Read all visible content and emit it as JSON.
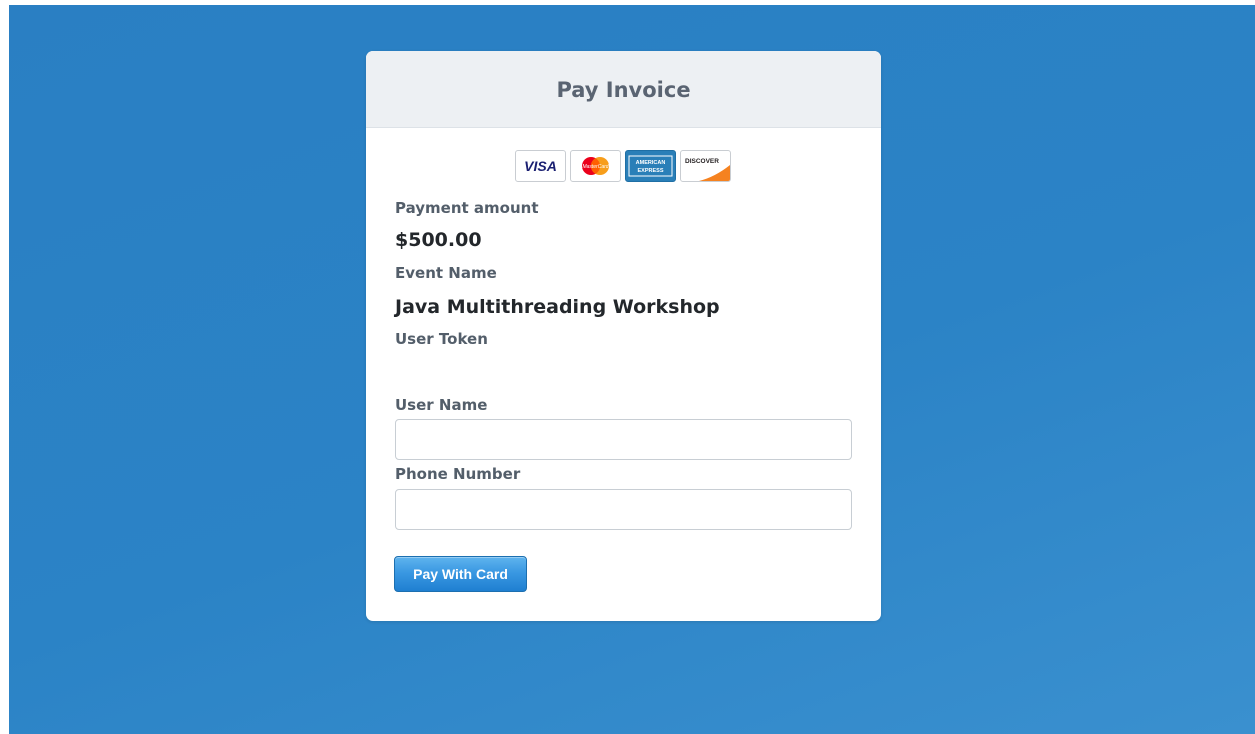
{
  "form": {
    "title": "Pay Invoice",
    "card_logos": [
      {
        "icon": "visa-logo-icon",
        "text": "VISA"
      },
      {
        "icon": "mastercard-logo-icon",
        "text": "MasterCard"
      },
      {
        "icon": "amex-logo-icon",
        "text": "AMERICAN EXPRESS"
      },
      {
        "icon": "discover-logo-icon",
        "text": "DISCOVER"
      }
    ],
    "payment_amount_label": "Payment amount",
    "payment_amount_value": "$500.00",
    "event_name_label": "Event Name",
    "event_name_value": "Java Multithreading Workshop",
    "user_token_label": "User Token",
    "user_token_value": "",
    "user_name_label": "User Name",
    "user_name_value": "",
    "user_name_placeholder": "",
    "phone_number_label": "Phone Number",
    "phone_number_value": "",
    "phone_number_placeholder": "",
    "pay_button_label": "Pay With Card"
  },
  "colors": {
    "background": "#2b83c6",
    "header_bg": "#edf0f3",
    "button_bg": "#3a98e2",
    "label_text": "#535e6a",
    "value_text": "#23272b"
  }
}
